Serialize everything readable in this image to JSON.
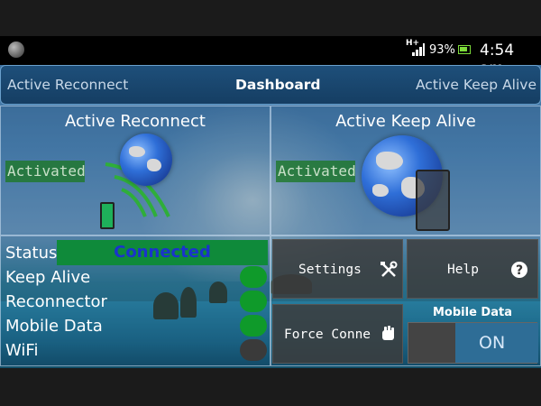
{
  "statusbar": {
    "network_type": "H+",
    "battery_percent": "93%",
    "time": "4:54 am"
  },
  "tabs": {
    "left": "Active Reconnect",
    "center": "Dashboard",
    "right": "Active Keep Alive"
  },
  "reconnect_panel": {
    "title": "Active Reconnect",
    "state": "Activated"
  },
  "keepalive_panel": {
    "title": "Active Keep Alive",
    "state": "Activated"
  },
  "status": {
    "status_label": "Status",
    "status_value": "Connected",
    "rows": [
      {
        "label": "Keep Alive",
        "on": true
      },
      {
        "label": "Reconnector",
        "on": true
      },
      {
        "label": "Mobile Data",
        "on": true
      },
      {
        "label": "WiFi",
        "on": false
      }
    ]
  },
  "controls": {
    "settings_label": "Settings",
    "help_label": "Help",
    "force_connect_label": "Force Conne",
    "mobile_data_label": "Mobile Data",
    "mobile_data_toggle": "ON"
  },
  "colors": {
    "activated_bg": "#1e7828",
    "connected_bg": "#0f8a3a",
    "connected_text": "#1a33cc",
    "toggle_on": "#0f9a2a",
    "toggle_off": "#3a3a3a",
    "on_toggle": "#2e6d96"
  },
  "icons": {
    "app": "globe-icon",
    "signal": "signal-bars-icon",
    "battery": "battery-icon",
    "settings": "tools-icon",
    "help": "question-icon",
    "force_connect": "fist-icon"
  }
}
